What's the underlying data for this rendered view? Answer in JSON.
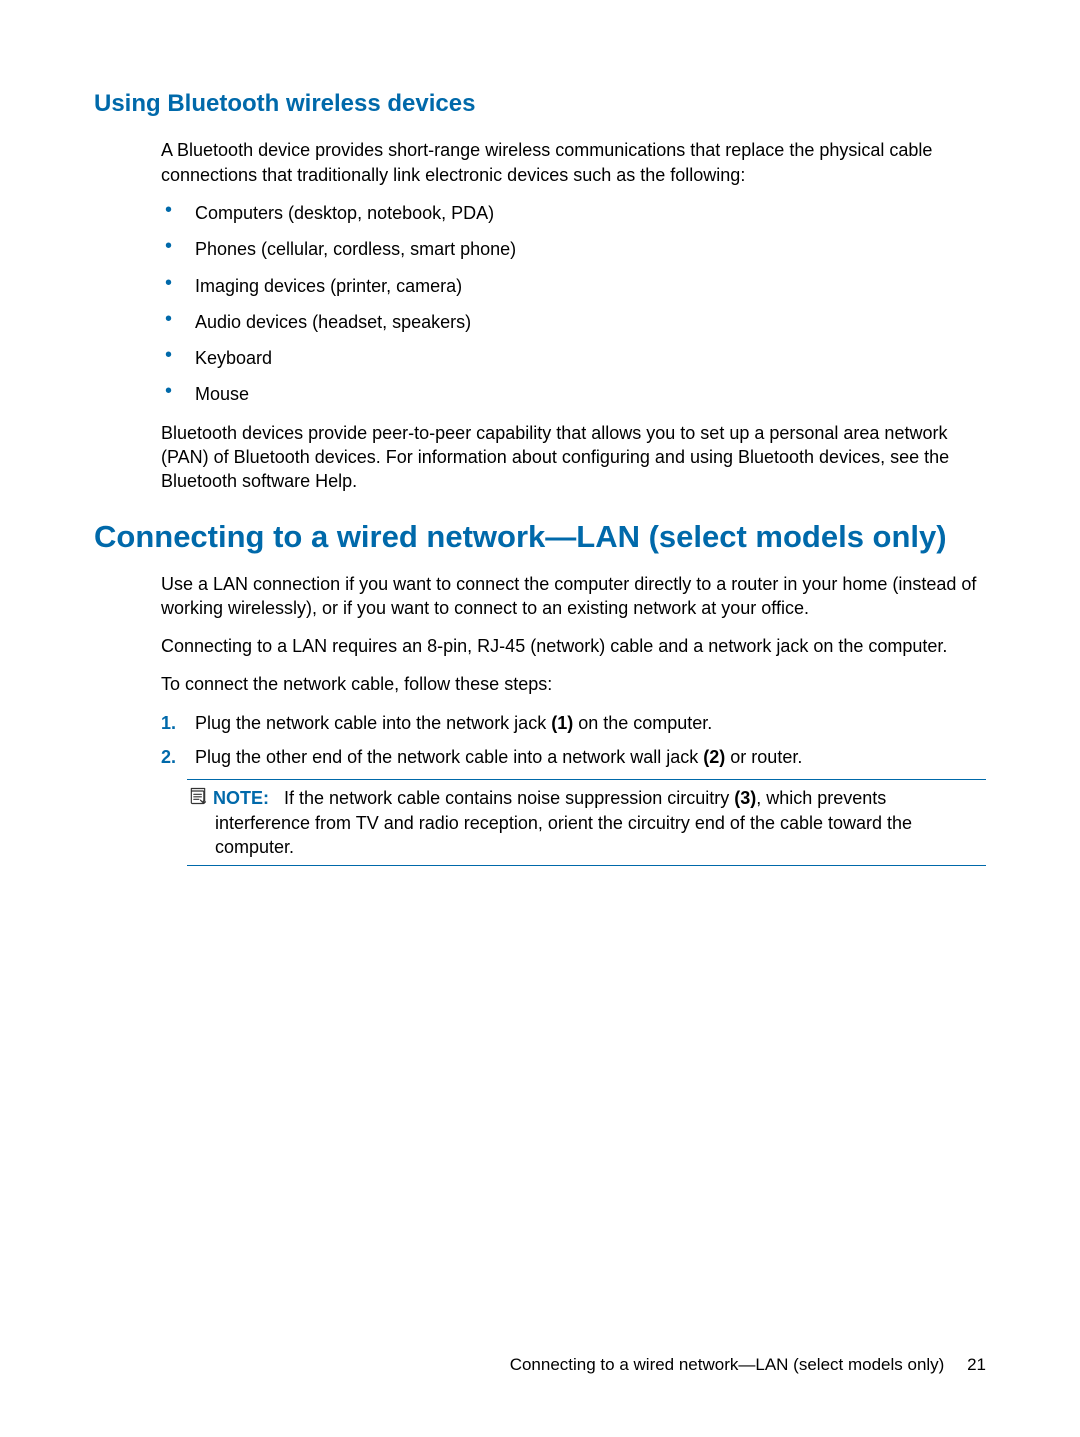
{
  "section1": {
    "heading": "Using Bluetooth wireless devices",
    "intro": "A Bluetooth device provides short-range wireless communications that replace the physical cable connections that traditionally link electronic devices such as the following:",
    "bullets": [
      "Computers (desktop, notebook, PDA)",
      "Phones (cellular, cordless, smart phone)",
      "Imaging devices (printer, camera)",
      "Audio devices (headset, speakers)",
      "Keyboard",
      "Mouse"
    ],
    "outro": "Bluetooth devices provide peer-to-peer capability that allows you to set up a personal area network (PAN) of Bluetooth devices. For information about configuring and using Bluetooth devices, see the Bluetooth software Help."
  },
  "section2": {
    "heading": "Connecting to a wired network—LAN (select models only)",
    "p1": "Use a LAN connection if you want to connect the computer directly to a router in your home (instead of working wirelessly), or if you want to connect to an existing network at your office.",
    "p2": "Connecting to a LAN requires an 8-pin, RJ-45 (network) cable and a network jack on the computer.",
    "p3": "To connect the network cable, follow these steps:",
    "steps": {
      "s1_num": "1.",
      "s1_a": "Plug the network cable into the network jack ",
      "s1_b": "(1)",
      "s1_c": " on the computer.",
      "s2_num": "2.",
      "s2_a": "Plug the other end of the network cable into a network wall jack ",
      "s2_b": "(2)",
      "s2_c": " or router."
    },
    "note": {
      "label": "NOTE:",
      "a": "If the network cable contains noise suppression circuitry ",
      "b": "(3)",
      "c": ", which prevents interference from TV and radio reception, orient the circuitry end of the cable toward the computer."
    }
  },
  "footer": {
    "text": "Connecting to a wired network—LAN (select models only)",
    "page": "21"
  }
}
